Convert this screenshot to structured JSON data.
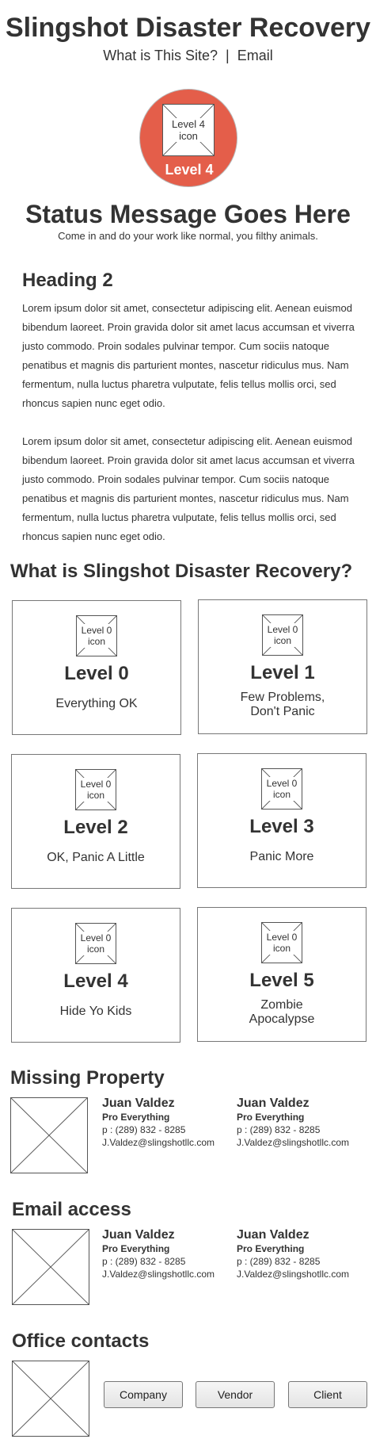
{
  "header": {
    "title": "Slingshot Disaster Recovery",
    "nav": [
      {
        "label": "What is This Site?"
      },
      {
        "label": "|"
      },
      {
        "label": "Email"
      }
    ]
  },
  "current_level": {
    "icon_text": "Level 4 icon",
    "label": "Level 4",
    "color": "#e45e4a"
  },
  "status": {
    "title": "Status Message Goes Here",
    "subtitle": "Come in and do your work like normal, you filthy animals."
  },
  "content": {
    "heading": "Heading 2",
    "paragraphs": [
      "Lorem ipsum dolor sit amet, consectetur adipiscing elit. Aenean euismod bibendum laoreet. Proin gravida dolor sit amet lacus accumsan et viverra justo commodo. Proin sodales pulvinar tempor. Cum sociis natoque penatibus et magnis dis parturient montes, nascetur ridiculus mus. Nam fermentum, nulla luctus pharetra vulputate, felis tellus mollis orci, sed rhoncus sapien nunc eget odio.",
      "Lorem ipsum dolor sit amet, consectetur adipiscing elit. Aenean euismod bibendum laoreet. Proin gravida dolor sit amet lacus accumsan et viverra justo commodo. Proin sodales pulvinar tempor. Cum sociis natoque penatibus et magnis dis parturient montes, nascetur ridiculus mus. Nam fermentum, nulla luctus pharetra vulputate, felis tellus mollis orci, sed rhoncus sapien nunc eget odio."
    ]
  },
  "levels_section": {
    "title": "What is Slingshot Disaster Recovery?",
    "levels": [
      {
        "icon_text": "Level 0 icon",
        "title": "Level 0",
        "desc": "Everything OK"
      },
      {
        "icon_text": "Level 0 icon",
        "title": "Level 1",
        "desc": "Few Problems, Don't Panic"
      },
      {
        "icon_text": "Level 0 icon",
        "title": "Level 2",
        "desc": "OK, Panic A Little"
      },
      {
        "icon_text": "Level 0 icon",
        "title": "Level 3",
        "desc": "Panic More"
      },
      {
        "icon_text": "Level 0 icon",
        "title": "Level 4",
        "desc": "Hide Yo Kids"
      },
      {
        "icon_text": "Level 0 icon",
        "title": "Level 5",
        "desc": "Zombie Apocalypse"
      }
    ]
  },
  "missing_property": {
    "title": "Missing Property",
    "contacts": [
      {
        "name": "Juan Valdez",
        "role": "Pro Everything",
        "phone": "p : (289) 832 - 8285",
        "email": "J.Valdez@slingshotllc.com"
      },
      {
        "name": "Juan Valdez",
        "role": "Pro Everything",
        "phone": "p : (289) 832 - 8285",
        "email": "J.Valdez@slingshotllc.com"
      }
    ]
  },
  "email_access": {
    "title": "Email access",
    "contacts": [
      {
        "name": "Juan Valdez",
        "role": "Pro Everything",
        "phone": "p : (289) 832 - 8285",
        "email": "J.Valdez@slingshotllc.com"
      },
      {
        "name": "Juan Valdez",
        "role": "Pro Everything",
        "phone": "p : (289) 832 - 8285",
        "email": "J.Valdez@slingshotllc.com"
      }
    ]
  },
  "office_contacts": {
    "title": "Office contacts",
    "buttons": [
      {
        "label": "Company"
      },
      {
        "label": "Vendor"
      },
      {
        "label": "Client"
      }
    ]
  }
}
